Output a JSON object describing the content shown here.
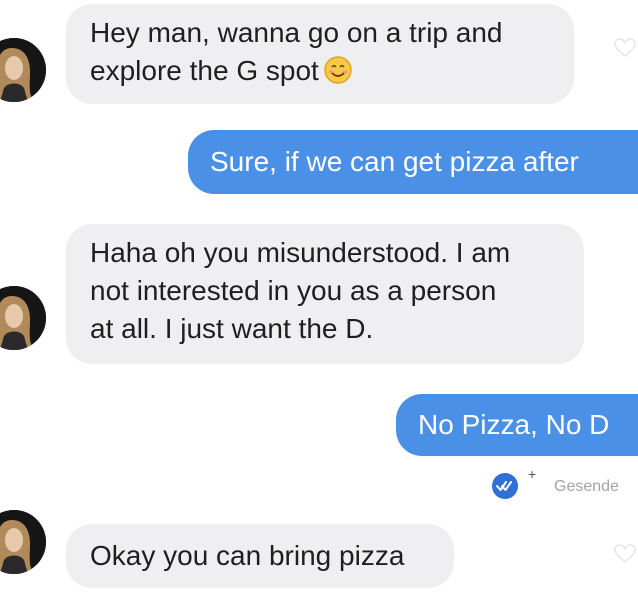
{
  "messages": [
    {
      "side": "in",
      "text_lines": [
        "Hey man, wanna go on a trip and",
        "explore the G spot"
      ],
      "emoji": "smiling-face-emoji"
    },
    {
      "side": "out",
      "text": "Sure, if we can get pizza after"
    },
    {
      "side": "in",
      "text_lines": [
        "Haha oh you misunderstood. I am",
        "not interested in you as a person",
        "at all. I just want the D."
      ]
    },
    {
      "side": "out",
      "text": "No Pizza, No D"
    },
    {
      "side": "in",
      "text_lines": [
        "Okay you can bring pizza"
      ]
    }
  ],
  "status": {
    "read_icon": "double-check-icon",
    "plus": "+",
    "sent_label": "Gesende"
  },
  "colors": {
    "incoming_bubble": "#efeff1",
    "outgoing_bubble": "#4a90e6",
    "read_badge": "#2f6fd6"
  }
}
